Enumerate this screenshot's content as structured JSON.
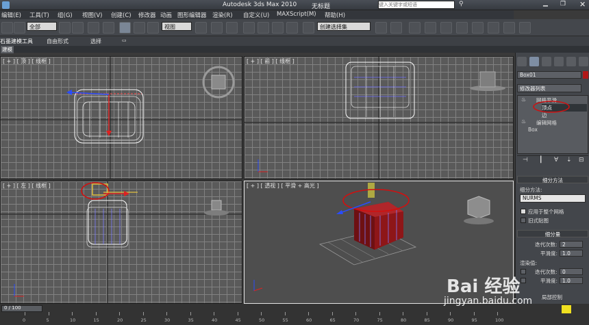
{
  "titlebar": {
    "app_title": "Autodesk 3ds Max  2010",
    "doc_title": "无标题",
    "search_placeholder": "键入关键字或短语"
  },
  "menu": [
    "编辑(E)",
    "工具(T)",
    "组(G)",
    "视图(V)",
    "创建(C)",
    "修改器",
    "动画",
    "图形编辑器",
    "渲染(R)",
    "自定义(U)",
    "MAXScript(M)",
    "帮助(H)"
  ],
  "toolbar": {
    "selection_filter": "全部",
    "coord_system": "视图",
    "named_selection": "创建选择集"
  },
  "ribbon": {
    "tabs": [
      "石墨建模工具",
      "自由形式",
      "选择"
    ],
    "sub": "建模"
  },
  "viewports": {
    "top": "[ + ] [ 顶 ] [ 线框 ]",
    "front": "[ + ] [ 前 ] [ 线框 ]",
    "left": "[ + ] [ 左 ] [ 线框 ]",
    "persp": "[ + ] [ 透视 ] [ 平滑 + 高光 ]"
  },
  "command_panel": {
    "object_name": "Box01",
    "modifier_list": "修改器列表",
    "stack": [
      "网格平滑",
      "顶点",
      "边",
      "编辑网格",
      "Box"
    ],
    "subdiv_section": "细分方法",
    "subdiv_method_label": "细分方法:",
    "subdiv_method": "NURMS",
    "apply_whole": "应用于整个网格",
    "old_style": "旧式贴图",
    "subdiv_amount": "细分量",
    "iterations_label": "迭代次数:",
    "iterations": "2",
    "smoothness_label": "平滑度:",
    "smoothness": "1.0",
    "render_values": "渲染值:",
    "render_iterations_label": "迭代次数:",
    "render_iterations": "0",
    "render_smoothness_label": "平滑度:",
    "render_smoothness": "1.0",
    "reset": "局部控制"
  },
  "timeline": {
    "frame": "0 / 100",
    "ticks": [
      "0",
      "5",
      "10",
      "15",
      "20",
      "25",
      "30",
      "35",
      "40",
      "45",
      "50",
      "55",
      "60",
      "65",
      "70",
      "75",
      "80",
      "85",
      "90",
      "95",
      "100"
    ]
  },
  "watermark": {
    "brand": "Bai 经验",
    "url": "jingyan.baidu.com"
  }
}
